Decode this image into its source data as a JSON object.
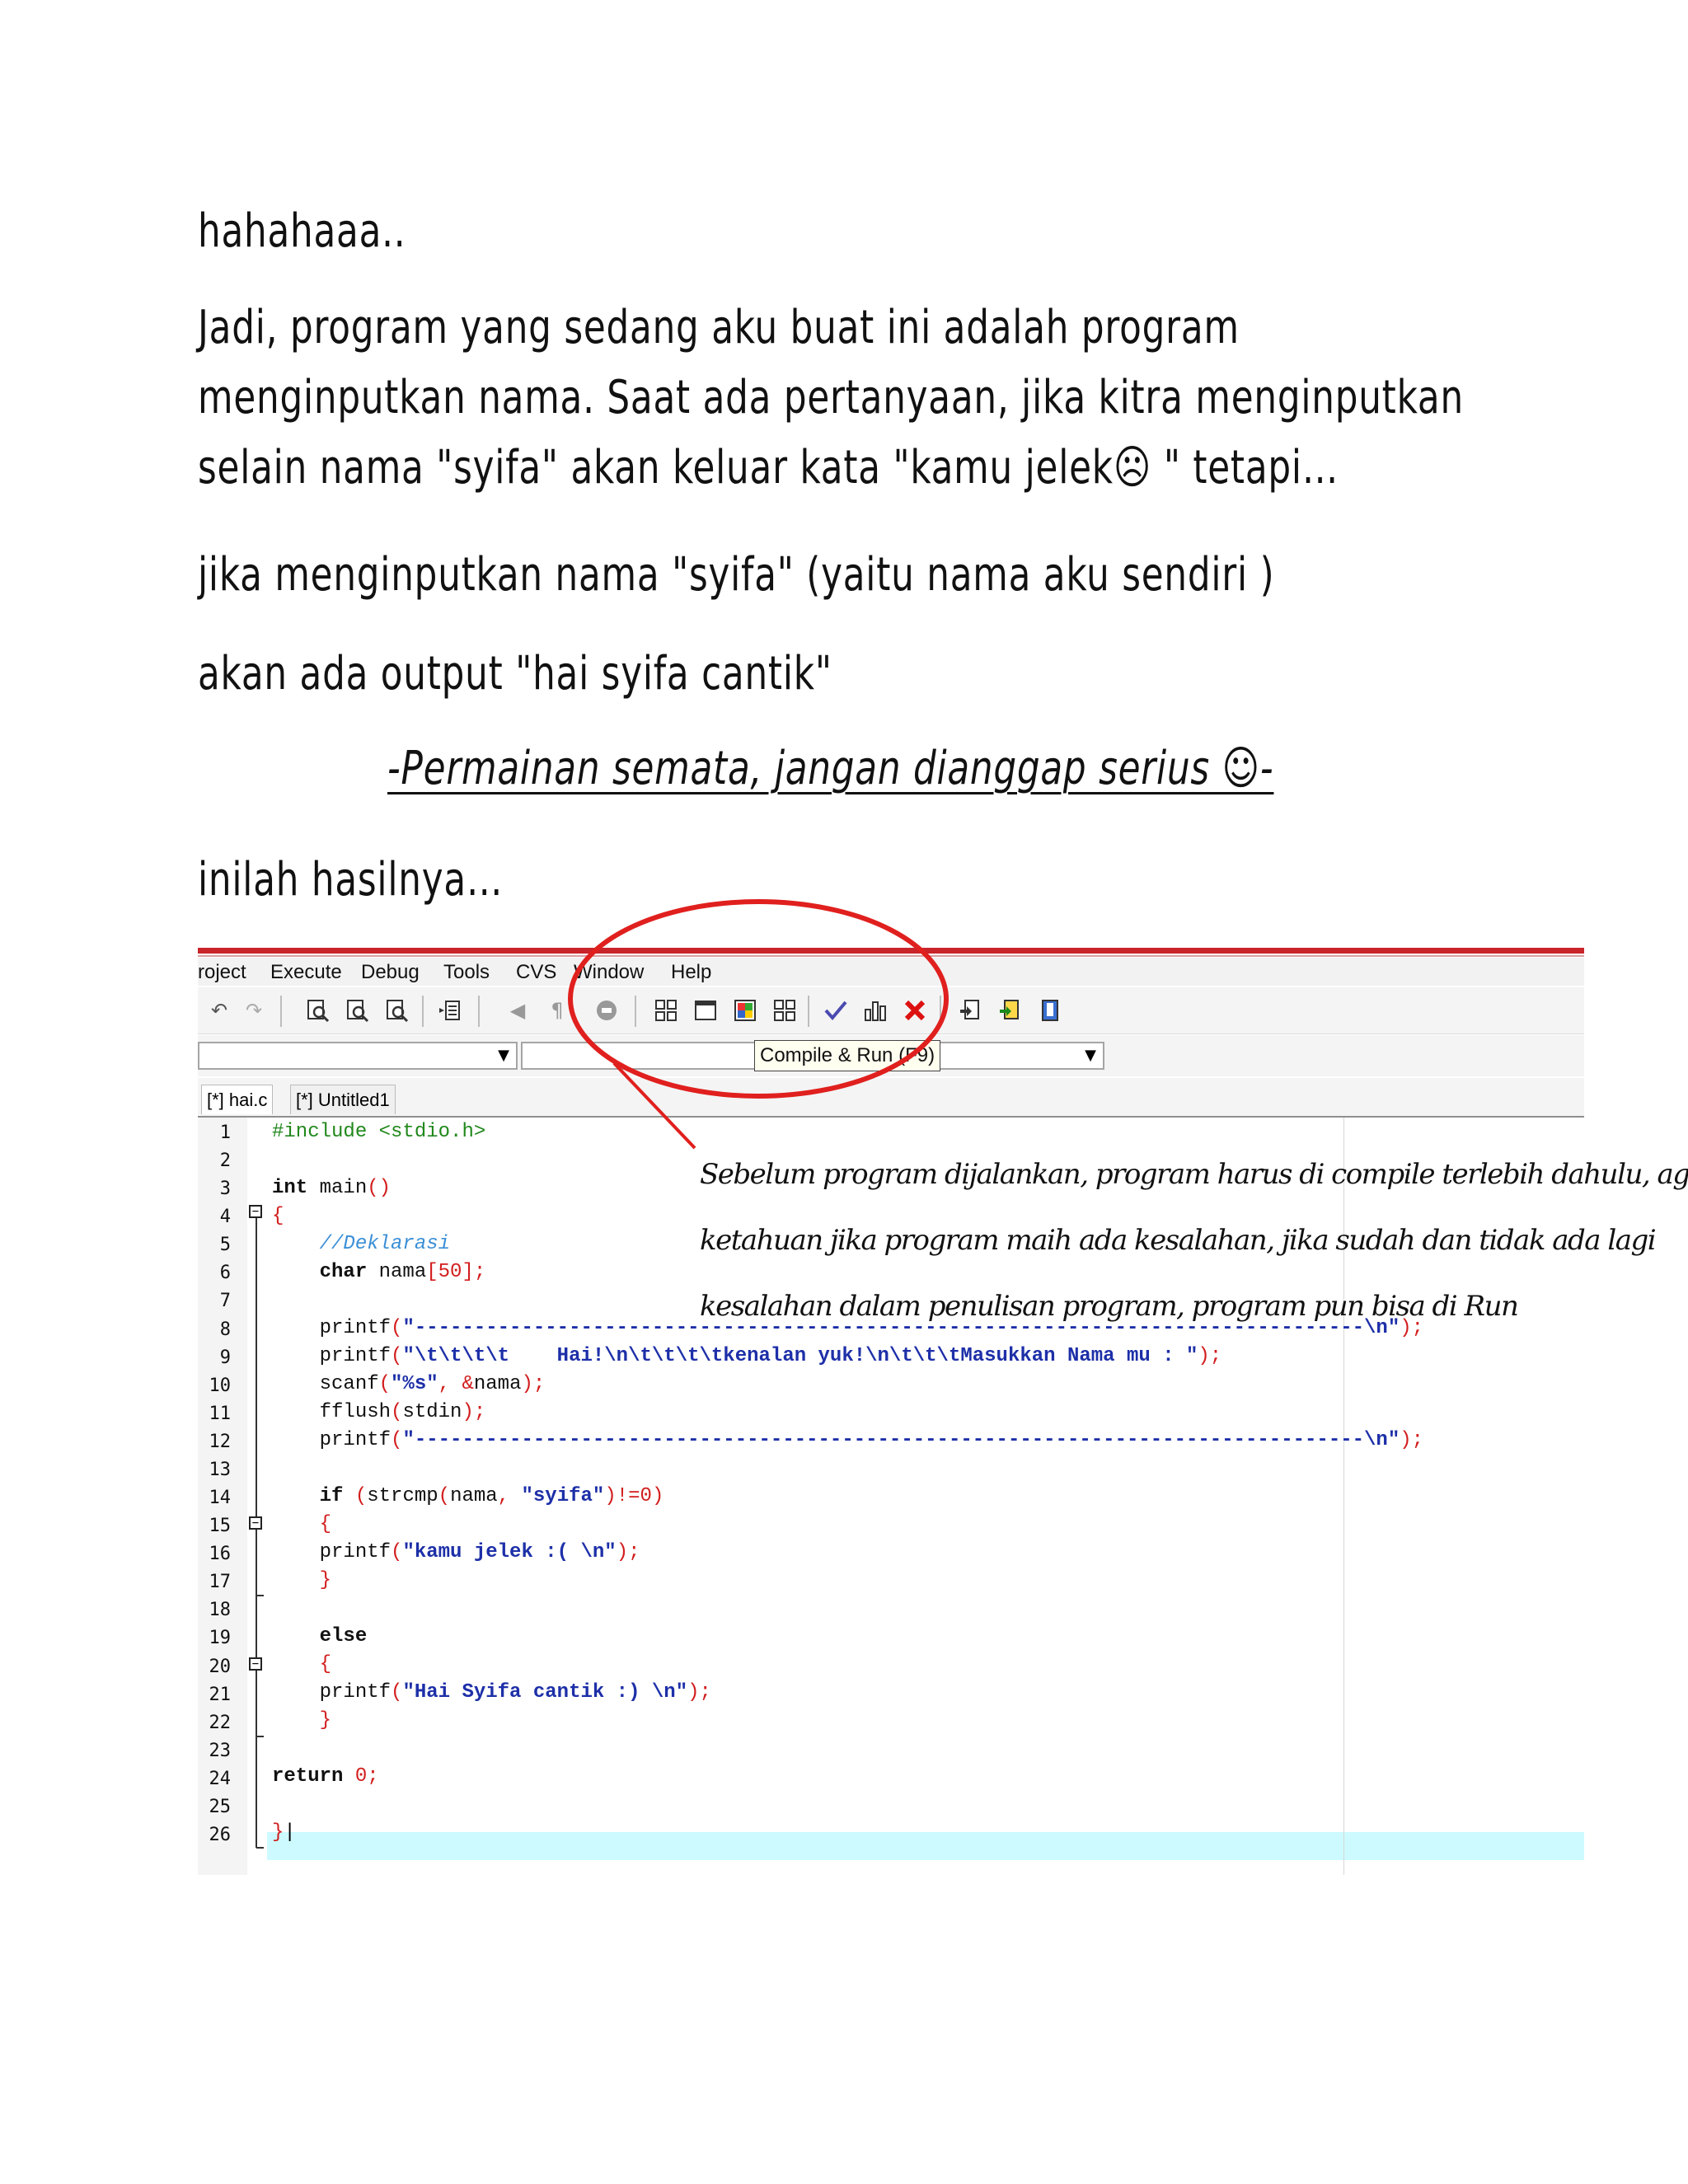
{
  "page_text": {
    "line1": "hahahaaa..",
    "line2": "Jadi, program yang sedang aku buat ini adalah program",
    "line3": "menginputkan nama. Saat ada pertanyaan, jika kitra menginputkan",
    "line4": "selain nama \"syifa\" akan keluar kata \"kamu jelek☹ \" tetapi…",
    "line5": "jika menginputkan nama \"syifa\"  (yaitu nama aku sendiri )",
    "line6": "akan ada output \"hai syifa cantik\"",
    "line7": "-Permainan semata, jangan dianggap serius ☺-",
    "line8": "inilah hasilnya…"
  },
  "menu": [
    "roject",
    "Execute",
    "Debug",
    "Tools",
    "CVS",
    "Window",
    "Help"
  ],
  "tooltip": "Compile & Run (F9)",
  "tabs": [
    "[*] hai.c",
    "[*] Untitled1"
  ],
  "line_numbers": [
    "1",
    "2",
    "3",
    "4",
    "5",
    "6",
    "7",
    "8",
    "9",
    "10",
    "11",
    "12",
    "13",
    "14",
    "15",
    "16",
    "17",
    "18",
    "19",
    "20",
    "21",
    "22",
    "23",
    "24",
    "25",
    "26"
  ],
  "annotation": {
    "l1": "Sebelum program dijalankan, program harus di compile terlebih dahulu, agar",
    "l2": "ketahuan jika program maih ada kesalahan, jika sudah dan tidak ada lagi",
    "l3": "kesalahan dalam penulisan program, program pun bisa di Run"
  },
  "icons": [
    "undo-icon",
    "redo-icon",
    "find-icon",
    "find-replace-icon",
    "find-next-icon",
    "indent-icon",
    "bookmark-icon",
    "goto-icon",
    "stop-icon",
    "new-project-icon",
    "window-icon",
    "color-grid-icon",
    "class-browser-icon",
    "compile-icon",
    "chart-icon",
    "close-icon",
    "export-icon",
    "insert-icon",
    "debug-icon"
  ],
  "colors": {
    "circle": "#e0201e",
    "keyword": "#111111",
    "string": "#1d2fa8",
    "symbol": "#d21d1d",
    "comment": "#3b8fd6",
    "preprocessor": "#21881c",
    "current_line": "#ccfaff"
  }
}
